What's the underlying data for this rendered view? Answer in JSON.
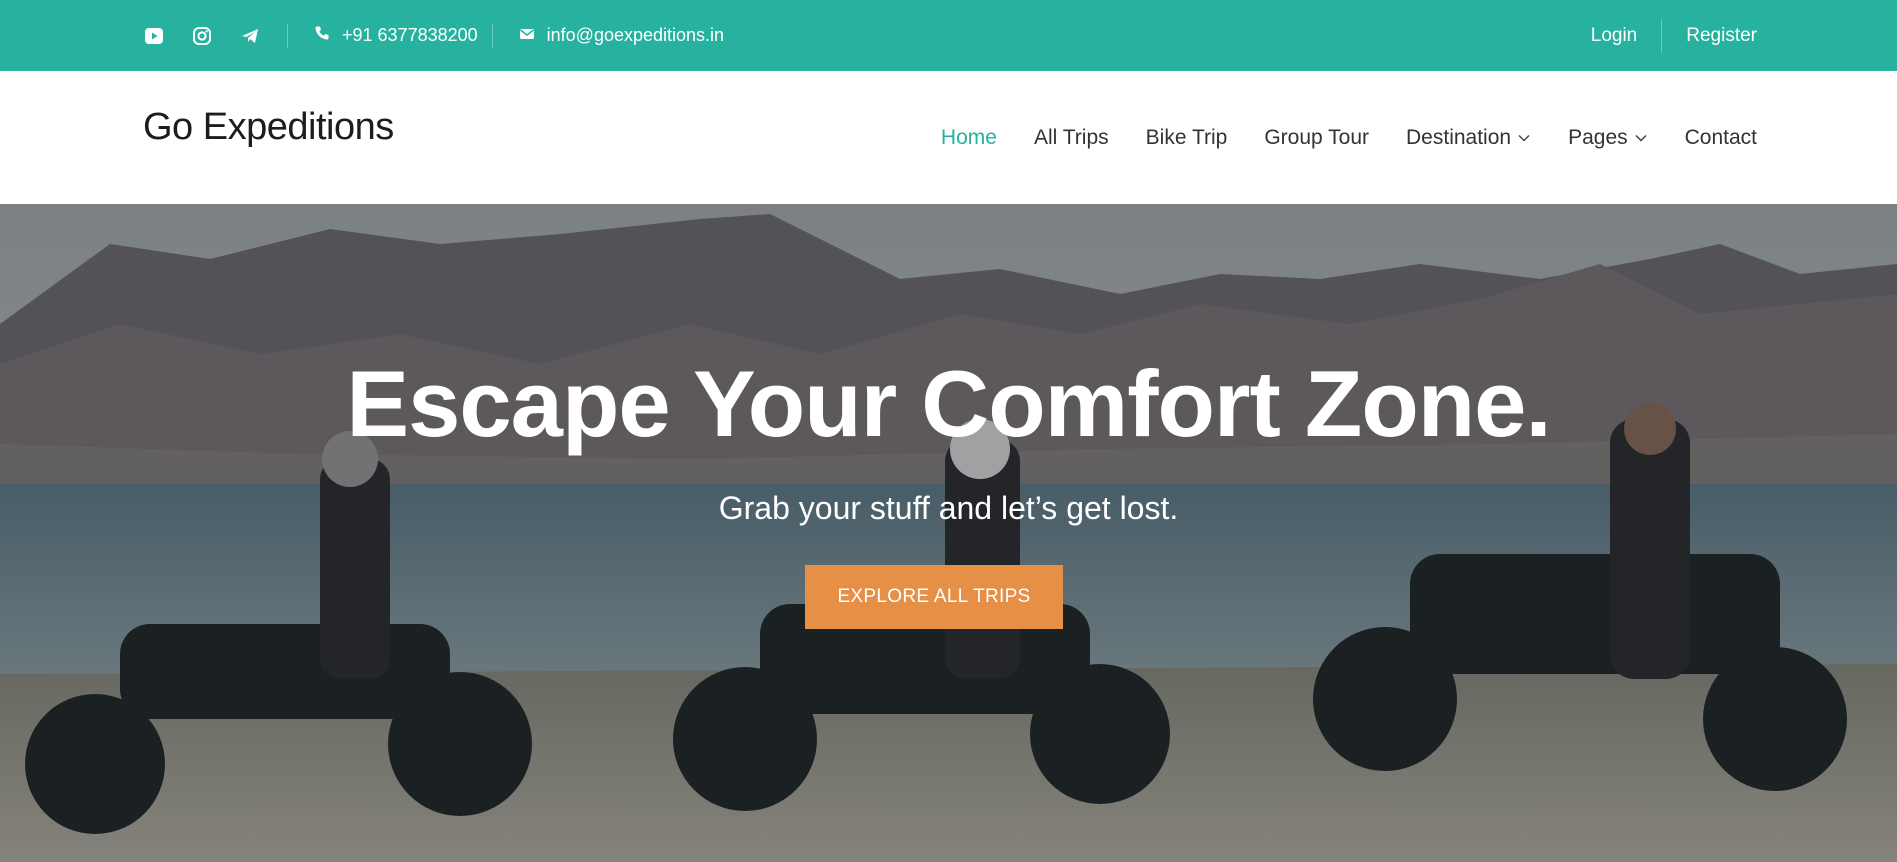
{
  "topbar": {
    "social": [
      {
        "icon": "youtube-icon"
      },
      {
        "icon": "instagram-icon"
      },
      {
        "icon": "telegram-icon"
      }
    ],
    "phone": "+91 6377838200",
    "email": "info@goexpeditions.in",
    "login_label": "Login",
    "register_label": "Register",
    "bg_color": "#27b2a0"
  },
  "header": {
    "logo": "Go Expeditions",
    "nav": {
      "home": "Home",
      "all_trips": "All Trips",
      "bike_trip": "Bike Trip",
      "group_tour": "Group Tour",
      "destination": "Destination",
      "pages": "Pages",
      "contact": "Contact"
    },
    "active_color": "#27b2a0"
  },
  "hero": {
    "title": "Escape Your Comfort Zone.",
    "subtitle": "Grab your stuff and let’s get lost.",
    "button_label": "EXPLORE ALL TRIPS",
    "button_color": "#e58f47"
  }
}
